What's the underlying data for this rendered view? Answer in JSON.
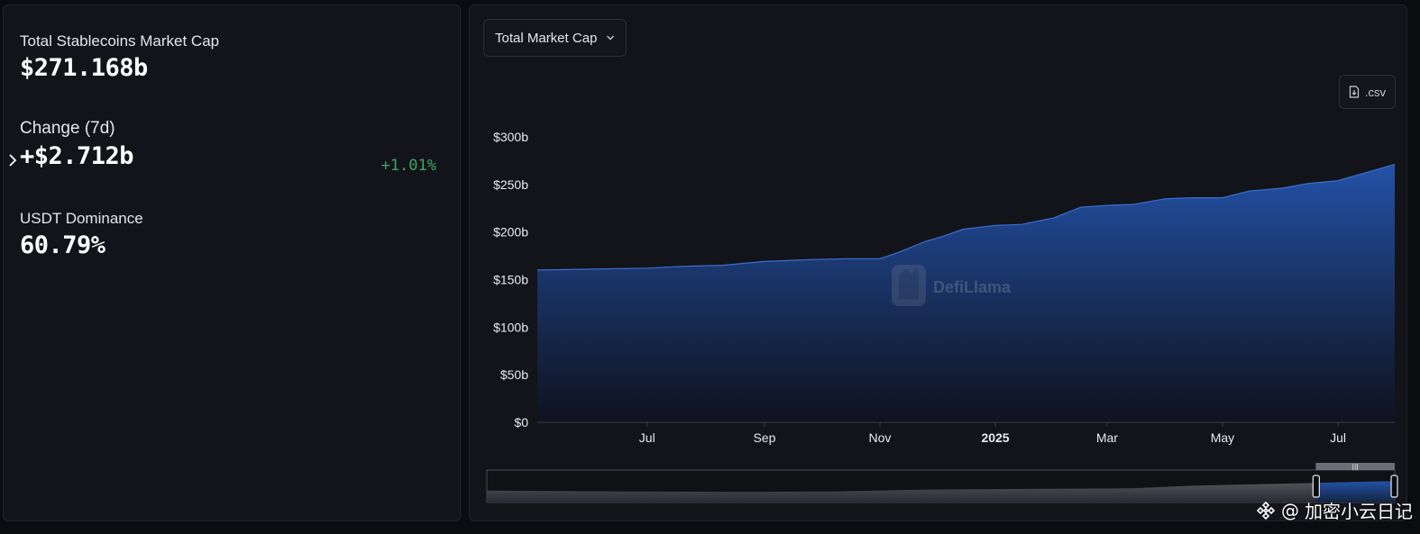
{
  "stats": {
    "total_label": "Total Stablecoins Market Cap",
    "total_value": "$271.168b",
    "change_label": "Change (7d)",
    "change_value": "+$2.712b",
    "change_pct": "+1.01%",
    "dominance_label": "USDT Dominance",
    "dominance_value": "60.79%"
  },
  "controls": {
    "metric_select": "Total Market Cap",
    "csv_label": ".csv"
  },
  "watermark": {
    "chart_brand": "DefiLlama",
    "corner_prefix": "@",
    "corner_text": "加密小云日记"
  },
  "colors": {
    "area_top": "#2352a8",
    "area_bottom": "#0f1220",
    "positive": "#3fa36a",
    "panel": "#131419"
  },
  "chart_data": {
    "type": "area",
    "title": "",
    "xlabel": "",
    "ylabel": "",
    "y_unit": "b",
    "ylim": [
      0,
      300
    ],
    "y_ticks": [
      "$0",
      "$50b",
      "$100b",
      "$150b",
      "$200b",
      "$250b",
      "$300b"
    ],
    "x_range": [
      "2024-05-04",
      "2025-07-31"
    ],
    "x_ticks": [
      {
        "date": "2024-07-01",
        "label": "Jul",
        "bold": false
      },
      {
        "date": "2024-09-01",
        "label": "Sep",
        "bold": false
      },
      {
        "date": "2024-11-01",
        "label": "Nov",
        "bold": false
      },
      {
        "date": "2025-01-01",
        "label": "2025",
        "bold": true
      },
      {
        "date": "2025-03-01",
        "label": "Mar",
        "bold": false
      },
      {
        "date": "2025-05-01",
        "label": "May",
        "bold": false
      },
      {
        "date": "2025-07-01",
        "label": "Jul",
        "bold": false
      }
    ],
    "grid": false,
    "series": [
      {
        "values": [
          {
            "x": "2024-05-04",
            "y": 160
          },
          {
            "x": "2024-06-01",
            "y": 161
          },
          {
            "x": "2024-07-01",
            "y": 162
          },
          {
            "x": "2024-07-20",
            "y": 164
          },
          {
            "x": "2024-08-10",
            "y": 165
          },
          {
            "x": "2024-09-01",
            "y": 169
          },
          {
            "x": "2024-09-25",
            "y": 171
          },
          {
            "x": "2024-10-15",
            "y": 172
          },
          {
            "x": "2024-11-01",
            "y": 172
          },
          {
            "x": "2024-11-10",
            "y": 178
          },
          {
            "x": "2024-11-25",
            "y": 190
          },
          {
            "x": "2024-12-05",
            "y": 196
          },
          {
            "x": "2024-12-15",
            "y": 203
          },
          {
            "x": "2025-01-01",
            "y": 207
          },
          {
            "x": "2025-01-15",
            "y": 208
          },
          {
            "x": "2025-02-01",
            "y": 215
          },
          {
            "x": "2025-02-15",
            "y": 226
          },
          {
            "x": "2025-03-01",
            "y": 228
          },
          {
            "x": "2025-03-15",
            "y": 229
          },
          {
            "x": "2025-04-01",
            "y": 235
          },
          {
            "x": "2025-04-15",
            "y": 236
          },
          {
            "x": "2025-05-01",
            "y": 236
          },
          {
            "x": "2025-05-15",
            "y": 243
          },
          {
            "x": "2025-06-01",
            "y": 246
          },
          {
            "x": "2025-06-15",
            "y": 251
          },
          {
            "x": "2025-07-01",
            "y": 254
          },
          {
            "x": "2025-07-15",
            "y": 262
          },
          {
            "x": "2025-07-31",
            "y": 271
          }
        ]
      }
    ],
    "brush": {
      "full_range": [
        "2023-01-01",
        "2025-07-31"
      ],
      "selected_range": [
        "2025-05-10",
        "2025-07-31"
      ],
      "values": [
        {
          "x": "2023-01-01",
          "y": 140
        },
        {
          "x": "2023-06-01",
          "y": 128
        },
        {
          "x": "2023-10-01",
          "y": 122
        },
        {
          "x": "2024-01-01",
          "y": 130
        },
        {
          "x": "2024-04-01",
          "y": 155
        },
        {
          "x": "2024-07-01",
          "y": 162
        },
        {
          "x": "2024-11-01",
          "y": 172
        },
        {
          "x": "2025-01-01",
          "y": 207
        },
        {
          "x": "2025-04-01",
          "y": 235
        },
        {
          "x": "2025-07-31",
          "y": 271
        }
      ]
    }
  }
}
